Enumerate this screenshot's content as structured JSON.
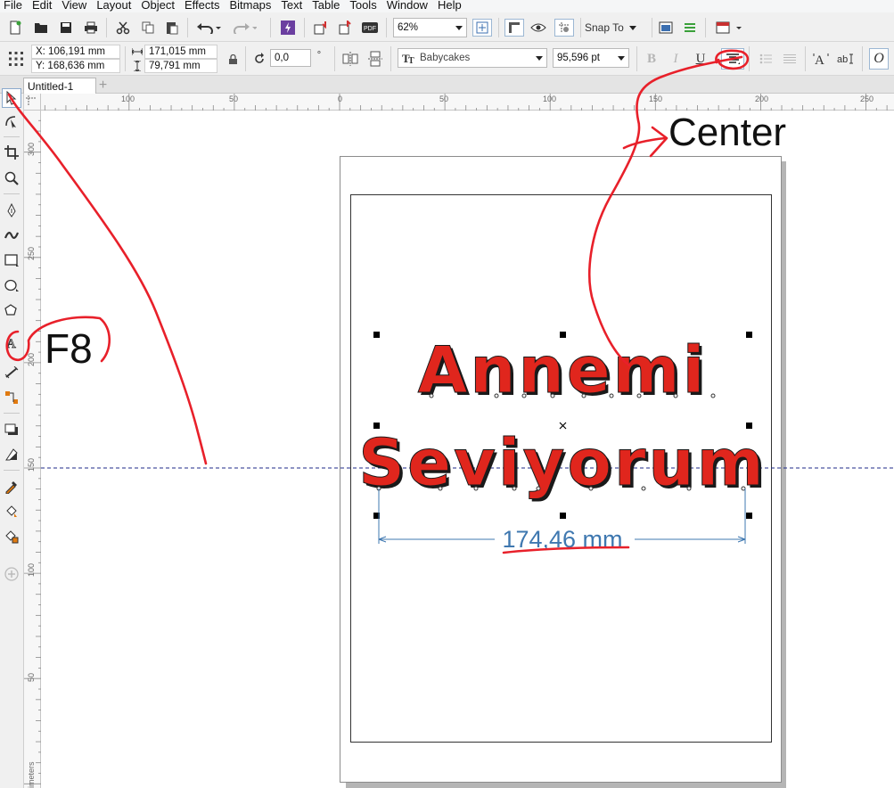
{
  "menu": [
    "File",
    "Edit",
    "View",
    "Layout",
    "Object",
    "Effects",
    "Bitmaps",
    "Text",
    "Table",
    "Tools",
    "Window",
    "Help"
  ],
  "standard_toolbar": {
    "zoom": "62%",
    "snap_to": "Snap To"
  },
  "property_bar": {
    "x": "X: 106,191 mm",
    "y": "Y: 168,636 mm",
    "width": "171,015 mm",
    "height": "79,791 mm",
    "rotation": "0,0",
    "degree_symbol": "°",
    "font_name": "Babycakes",
    "font_size": "95,596 pt"
  },
  "document": {
    "tab": "Untitled-1"
  },
  "ruler": {
    "horizontal": [
      "100",
      "50",
      "0",
      "50",
      "100",
      "150",
      "200",
      "250"
    ],
    "vertical": [
      "300",
      "250",
      "200",
      "150",
      "100",
      "50"
    ],
    "unit": "imeters"
  },
  "artwork": {
    "line1": "Annemi",
    "line2": "Seviyorum",
    "measurement": "174,46 mm",
    "text_color": "#e0261d",
    "outline_color": "#1a1a1a"
  },
  "annotations": {
    "center": "Center",
    "f8": "F8",
    "color": "#e8202a"
  },
  "colors": {
    "guideline": "#1e2a8a",
    "dimension": "#3f78b0"
  }
}
